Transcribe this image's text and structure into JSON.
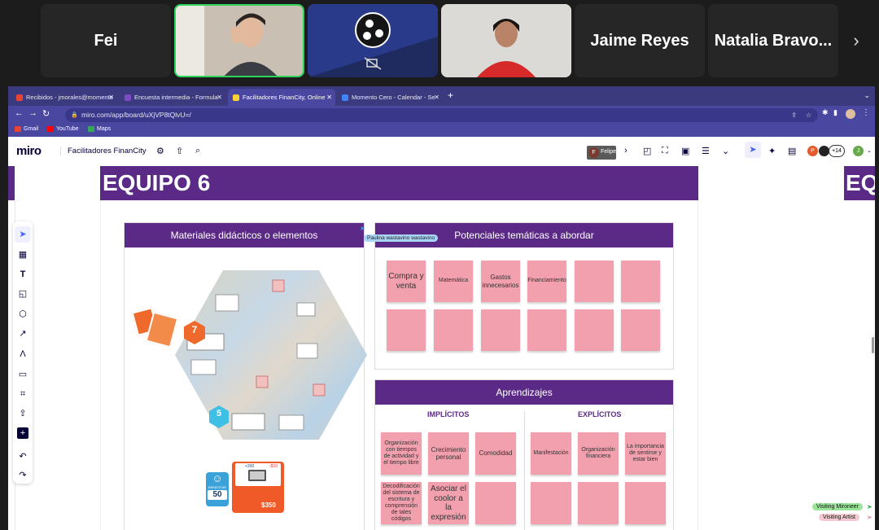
{
  "meeting": {
    "participants": [
      {
        "name": "Fei",
        "type": "name"
      },
      {
        "name": "",
        "type": "video"
      },
      {
        "name": "",
        "type": "obs"
      },
      {
        "name": "",
        "type": "video"
      },
      {
        "name": "Jaime Reyes",
        "type": "name"
      },
      {
        "name": "Natalia Bravo...",
        "type": "name"
      }
    ],
    "next_icon": "chevron-right-icon"
  },
  "browser": {
    "tabs": [
      {
        "label": "Recibidos - jmorales@momento",
        "color": "#ea4335"
      },
      {
        "label": "Encuesta intermedia - Formula",
        "color": "#7b4cc2"
      },
      {
        "label": "Facilitadores FinanCity, Online",
        "color": "#ffd02f"
      },
      {
        "label": "Momento Cero - Calendar - Se",
        "color": "#4285f4"
      }
    ],
    "url": "miro.com/app/board/uXjVP8tQlvU=/",
    "bookmarks": [
      {
        "label": "Gmail",
        "color": "#ea4335"
      },
      {
        "label": "YouTube",
        "color": "#ff0000"
      },
      {
        "label": "Maps",
        "color": "#34a853"
      }
    ]
  },
  "miro": {
    "logo": "miro",
    "board_name": "Facilitadores FinanCity",
    "collaborator_initial": "F",
    "collaborator_label": "Felipe",
    "extra_users": "+14",
    "user_p": "P",
    "user_j": "J",
    "frame_title": "EQUIPO 6",
    "right_frame_title": "EQ",
    "cursor_name": "Paulina wastavino wastavino",
    "materials": {
      "title": "Materiales didácticos o elementos"
    },
    "potenciales": {
      "title": "Potenciales temáticas a abordar",
      "notes": [
        "Compra y venta",
        "Matemática",
        "Gastos innecesarios",
        "Financiamiento",
        "",
        "",
        "",
        "",
        "",
        "",
        "",
        ""
      ]
    },
    "aprendizajes": {
      "title": "Aprendizajes",
      "implicitos_label": "IMPLÍCITOS",
      "explicitos_label": "EXPLÍCITOS",
      "implicitos": [
        "Organización con tiempos de actividad y el tiempo libre",
        "Crecimiento personal",
        "Comodidad",
        "Decodificación del sistema de escritura y comprensión de tales códigos",
        "Asociar el coolor a la expresión",
        ""
      ],
      "explicitos": [
        "Manifestación",
        "Organización financiera",
        "La importancia de sentirse y estar bien",
        "",
        "",
        ""
      ]
    },
    "game": {
      "badge7": "7",
      "badge5": "5",
      "bienestar_label": "BIENESTAR",
      "bienestar_value": "50",
      "card_price": "$350",
      "card_plus": "+300",
      "card_minus": "-$10"
    },
    "visiting": [
      "Visiting Mironeer",
      "Visiting Artist"
    ]
  }
}
